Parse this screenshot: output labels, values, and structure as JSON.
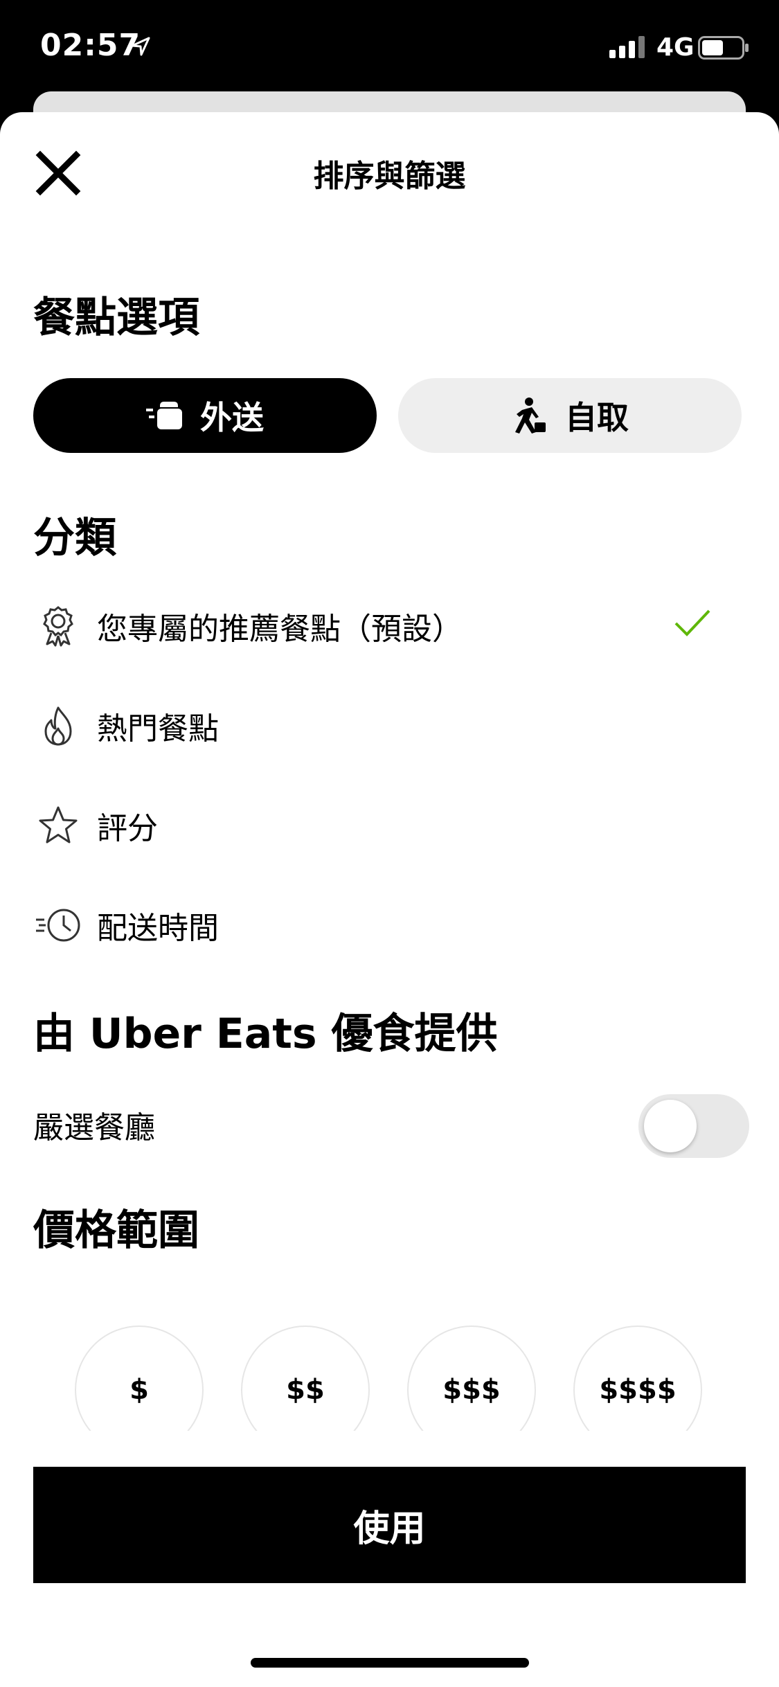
{
  "status_bar": {
    "time": "02:57",
    "network": "4G"
  },
  "header": {
    "title": "排序與篩選"
  },
  "meal_options": {
    "title": "餐點選項",
    "delivery_label": "外送",
    "pickup_label": "自取"
  },
  "categories": {
    "title": "分類",
    "items": [
      {
        "label": "您專屬的推薦餐點（預設）",
        "icon": "badge-icon",
        "selected": true
      },
      {
        "label": "熱門餐點",
        "icon": "flame-icon"
      },
      {
        "label": "評分",
        "icon": "star-icon"
      },
      {
        "label": "配送時間",
        "icon": "fast-clock-icon"
      }
    ],
    "check_color": "#5fb709"
  },
  "provided_by": {
    "title": "由 Uber Eats 優食提供",
    "toggle_label": "嚴選餐廳",
    "toggle_on": false
  },
  "price_range": {
    "title": "價格範圍",
    "options": [
      "$",
      "$$",
      "$$$",
      "$$$$"
    ]
  },
  "apply_label": "使用"
}
